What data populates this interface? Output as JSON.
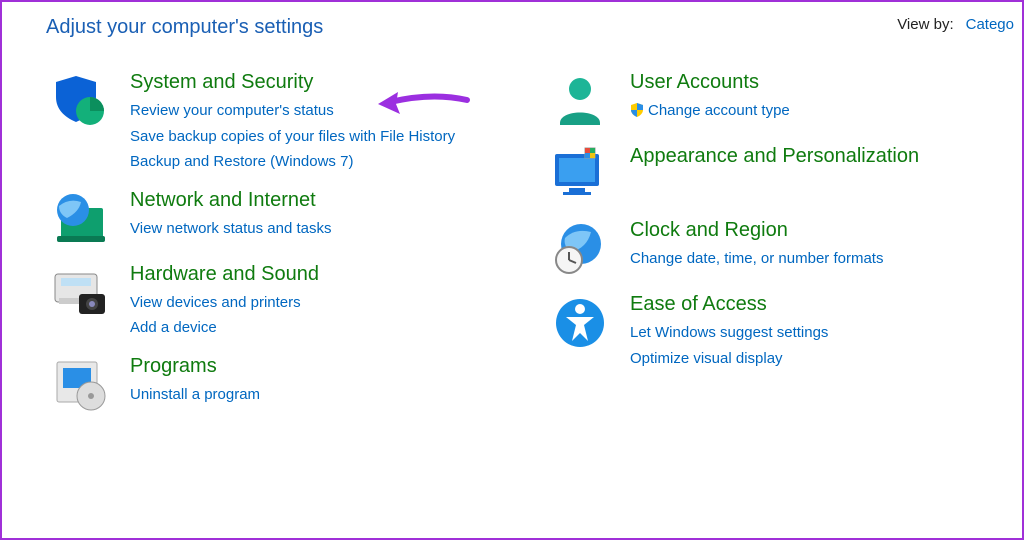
{
  "header": {
    "title": "Adjust your computer's settings",
    "view_by_label": "View by:",
    "view_by_value": "Catego"
  },
  "left": [
    {
      "icon": "shield-pie-icon",
      "title": "System and Security",
      "links": [
        "Review your computer's status",
        "Save backup copies of your files with File History",
        "Backup and Restore (Windows 7)"
      ]
    },
    {
      "icon": "globe-network-icon",
      "title": "Network and Internet",
      "links": [
        "View network status and tasks"
      ]
    },
    {
      "icon": "printer-camera-icon",
      "title": "Hardware and Sound",
      "links": [
        "View devices and printers",
        "Add a device"
      ]
    },
    {
      "icon": "programs-disc-icon",
      "title": "Programs",
      "links": [
        "Uninstall a program"
      ]
    }
  ],
  "right": [
    {
      "icon": "user-icon",
      "title": "User Accounts",
      "links": [
        {
          "shield": true,
          "text": "Change account type"
        }
      ]
    },
    {
      "icon": "monitor-colors-icon",
      "title": "Appearance and Personalization",
      "links": []
    },
    {
      "icon": "globe-clock-icon",
      "title": "Clock and Region",
      "links": [
        "Change date, time, or number formats"
      ]
    },
    {
      "icon": "accessibility-icon",
      "title": "Ease of Access",
      "links": [
        "Let Windows suggest settings",
        "Optimize visual display"
      ]
    }
  ],
  "colors": {
    "link_blue": "#0067c0",
    "title_green": "#0f7b0f",
    "arrow_purple": "#9b2fe0"
  }
}
